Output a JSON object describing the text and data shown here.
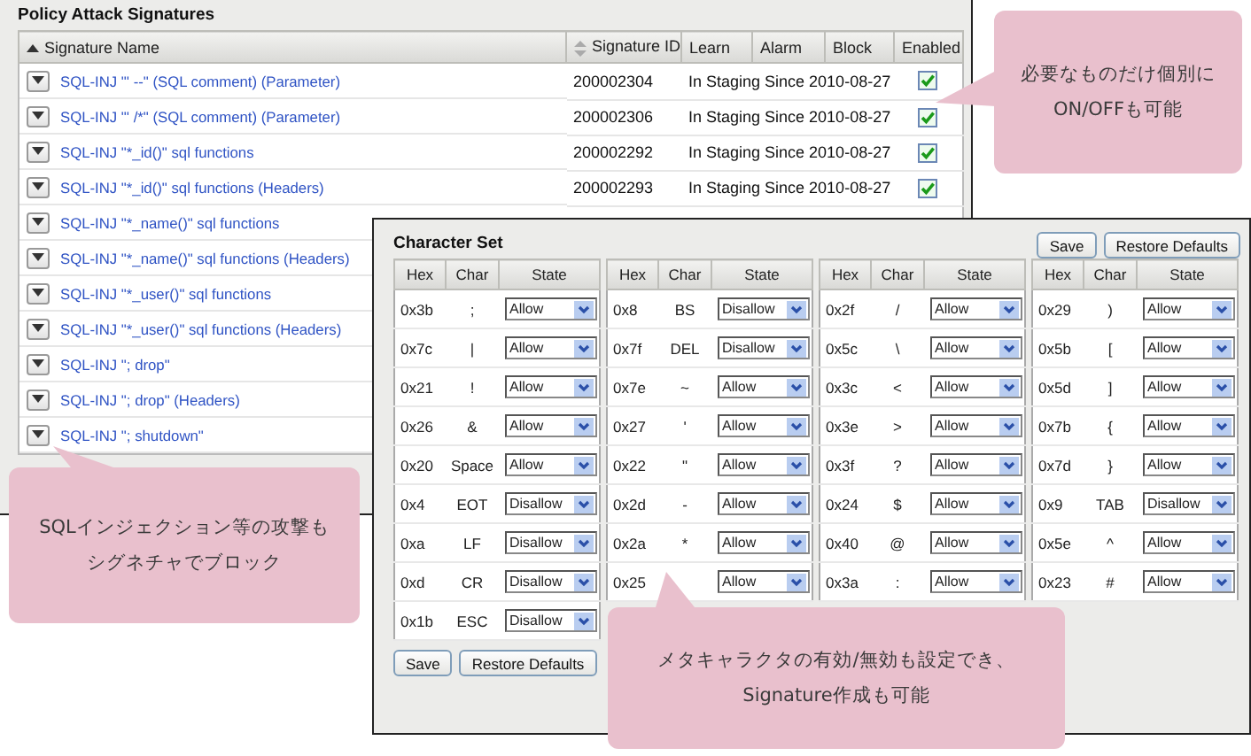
{
  "signatures": {
    "title": "Policy Attack Signatures",
    "columns": [
      {
        "label": "Signature Name",
        "sorted": true
      },
      {
        "label": "Signature ID",
        "sortable": true
      },
      {
        "label": "Learn"
      },
      {
        "label": "Alarm"
      },
      {
        "label": "Block"
      },
      {
        "label": "Enabled"
      }
    ],
    "rows": [
      {
        "name": "SQL-INJ \"' --\" (SQL comment) (Parameter)",
        "id": "200002304",
        "learn": "In Staging Since 2010-08-27",
        "enabled": true
      },
      {
        "name": "SQL-INJ \"' /*\" (SQL comment) (Parameter)",
        "id": "200002306",
        "learn": "In Staging Since 2010-08-27",
        "enabled": true
      },
      {
        "name": "SQL-INJ \"*_id()\" sql functions",
        "id": "200002292",
        "learn": "In Staging Since 2010-08-27",
        "enabled": true
      },
      {
        "name": "SQL-INJ \"*_id()\" sql functions (Headers)",
        "id": "200002293",
        "learn": "In Staging Since 2010-08-27",
        "enabled": true
      },
      {
        "name": "SQL-INJ \"*_name()\" sql functions"
      },
      {
        "name": "SQL-INJ \"*_name()\" sql functions (Headers)"
      },
      {
        "name": "SQL-INJ \"*_user()\" sql functions"
      },
      {
        "name": "SQL-INJ \"*_user()\" sql functions (Headers)"
      },
      {
        "name": "SQL-INJ \"; drop\""
      },
      {
        "name": "SQL-INJ \"; drop\" (Headers)"
      },
      {
        "name": "SQL-INJ \"; shutdown\""
      }
    ]
  },
  "character_set": {
    "title": "Character Set",
    "top_buttons": [
      "Save",
      "Restore Defaults"
    ],
    "bottom_buttons": [
      "Save",
      "Restore Defaults"
    ],
    "blocks": [
      {
        "columns": [
          "Hex",
          "Char",
          "State"
        ],
        "rows": [
          {
            "hex": "0x3b",
            "char": ";",
            "state": "Allow"
          },
          {
            "hex": "0x7c",
            "char": "|",
            "state": "Allow"
          },
          {
            "hex": "0x21",
            "char": "!",
            "state": "Allow"
          },
          {
            "hex": "0x26",
            "char": "&",
            "state": "Allow"
          },
          {
            "hex": "0x20",
            "char": "Space",
            "state": "Allow"
          },
          {
            "hex": "0x4",
            "char": "EOT",
            "state": "Disallow"
          },
          {
            "hex": "0xa",
            "char": "LF",
            "state": "Disallow"
          },
          {
            "hex": "0xd",
            "char": "CR",
            "state": "Disallow"
          },
          {
            "hex": "0x1b",
            "char": "ESC",
            "state": "Disallow"
          }
        ]
      },
      {
        "columns": [
          "Hex",
          "Char",
          "State"
        ],
        "rows": [
          {
            "hex": "0x8",
            "char": "BS",
            "state": "Disallow"
          },
          {
            "hex": "0x7f",
            "char": "DEL",
            "state": "Disallow"
          },
          {
            "hex": "0x7e",
            "char": "~",
            "state": "Allow"
          },
          {
            "hex": "0x27",
            "char": "'",
            "state": "Allow"
          },
          {
            "hex": "0x22",
            "char": "\"",
            "state": "Allow"
          },
          {
            "hex": "0x2d",
            "char": "-",
            "state": "Allow"
          },
          {
            "hex": "0x2a",
            "char": "*",
            "state": "Allow"
          },
          {
            "hex": "0x25",
            "state": "Allow"
          }
        ]
      },
      {
        "columns": [
          "Hex",
          "Char",
          "State"
        ],
        "rows": [
          {
            "hex": "0x2f",
            "char": "/",
            "state": "Allow"
          },
          {
            "hex": "0x5c",
            "char": "\\",
            "state": "Allow"
          },
          {
            "hex": "0x3c",
            "char": "<",
            "state": "Allow"
          },
          {
            "hex": "0x3e",
            "char": ">",
            "state": "Allow"
          },
          {
            "hex": "0x3f",
            "char": "?",
            "state": "Allow"
          },
          {
            "hex": "0x24",
            "char": "$",
            "state": "Allow"
          },
          {
            "hex": "0x40",
            "char": "@",
            "state": "Allow"
          },
          {
            "hex": "0x3a",
            "char": ":",
            "state": "Allow"
          }
        ]
      },
      {
        "columns": [
          "Hex",
          "Char",
          "State"
        ],
        "rows": [
          {
            "hex": "0x29",
            "char": ")",
            "state": "Allow"
          },
          {
            "hex": "0x5b",
            "char": "[",
            "state": "Allow"
          },
          {
            "hex": "0x5d",
            "char": "]",
            "state": "Allow"
          },
          {
            "hex": "0x7b",
            "char": "{",
            "state": "Allow"
          },
          {
            "hex": "0x7d",
            "char": "}",
            "state": "Allow"
          },
          {
            "hex": "0x9",
            "char": "TAB",
            "state": "Disallow"
          },
          {
            "hex": "0x5e",
            "char": "^",
            "state": "Allow"
          },
          {
            "hex": "0x23",
            "char": "#",
            "state": "Allow"
          }
        ]
      }
    ]
  },
  "callouts": [
    {
      "lines": [
        "必要なものだけ個別に",
        "ON/OFFも可能"
      ]
    },
    {
      "lines": [
        "SQLインジェクション等の攻撃も",
        "シグネチャでブロック"
      ]
    },
    {
      "lines": [
        "メタキャラクタの有効/無効も設定でき、",
        "Signature作成も可能"
      ]
    }
  ]
}
